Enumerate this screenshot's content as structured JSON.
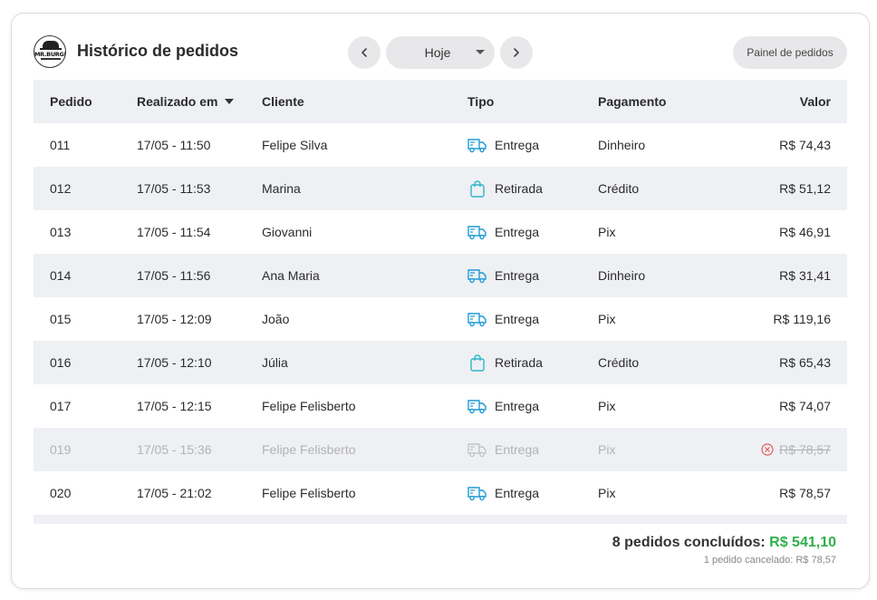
{
  "header": {
    "logo_text": "MR.BURGER",
    "title": "Histórico de pedidos",
    "date_filter": "Hoje",
    "panel_button": "Painel de pedidos"
  },
  "columns": {
    "pedido": "Pedido",
    "realizado": "Realizado em",
    "cliente": "Cliente",
    "tipo": "Tipo",
    "pagamento": "Pagamento",
    "valor": "Valor"
  },
  "orders": [
    {
      "id": "011",
      "date": "17/05 - 11:50",
      "client": "Felipe Silva",
      "type": "Entrega",
      "type_icon": "delivery-truck-icon",
      "payment": "Dinheiro",
      "value": "R$ 74,43",
      "cancelled": false
    },
    {
      "id": "012",
      "date": "17/05 - 11:53",
      "client": "Marina",
      "type": "Retirada",
      "type_icon": "shopping-bag-icon",
      "payment": "Crédito",
      "value": "R$ 51,12",
      "cancelled": false
    },
    {
      "id": "013",
      "date": "17/05 - 11:54",
      "client": "Giovanni",
      "type": "Entrega",
      "type_icon": "delivery-truck-icon",
      "payment": "Pix",
      "value": "R$ 46,91",
      "cancelled": false
    },
    {
      "id": "014",
      "date": "17/05 - 11:56",
      "client": "Ana Maria",
      "type": "Entrega",
      "type_icon": "delivery-truck-icon",
      "payment": "Dinheiro",
      "value": "R$ 31,41",
      "cancelled": false
    },
    {
      "id": "015",
      "date": "17/05 - 12:09",
      "client": "João",
      "type": "Entrega",
      "type_icon": "delivery-truck-icon",
      "payment": "Pix",
      "value": "R$ 119,16",
      "cancelled": false
    },
    {
      "id": "016",
      "date": "17/05 - 12:10",
      "client": "Júlia",
      "type": "Retirada",
      "type_icon": "shopping-bag-icon",
      "payment": "Crédito",
      "value": "R$ 65,43",
      "cancelled": false
    },
    {
      "id": "017",
      "date": "17/05 - 12:15",
      "client": "Felipe Felisberto",
      "type": "Entrega",
      "type_icon": "delivery-truck-icon",
      "payment": "Pix",
      "value": "R$ 74,07",
      "cancelled": false
    },
    {
      "id": "019",
      "date": "17/05 - 15:36",
      "client": "Felipe Felisberto",
      "type": "Entrega",
      "type_icon": "delivery-truck-icon",
      "payment": "Pix",
      "value": "R$ 78,57",
      "cancelled": true
    },
    {
      "id": "020",
      "date": "17/05 - 21:02",
      "client": "Felipe Felisberto",
      "type": "Entrega",
      "type_icon": "delivery-truck-icon",
      "payment": "Pix",
      "value": "R$ 78,57",
      "cancelled": false
    }
  ],
  "footer": {
    "completed_label": "8 pedidos concluídos:",
    "completed_total": "R$ 541,10",
    "cancelled_note": "1 pedido cancelado: R$ 78,57"
  },
  "colors": {
    "accent_blue": "#1e9bd7",
    "accent_teal": "#2bb6c9",
    "total_green": "#2fb14a",
    "cancel_red": "#e05a5a"
  }
}
